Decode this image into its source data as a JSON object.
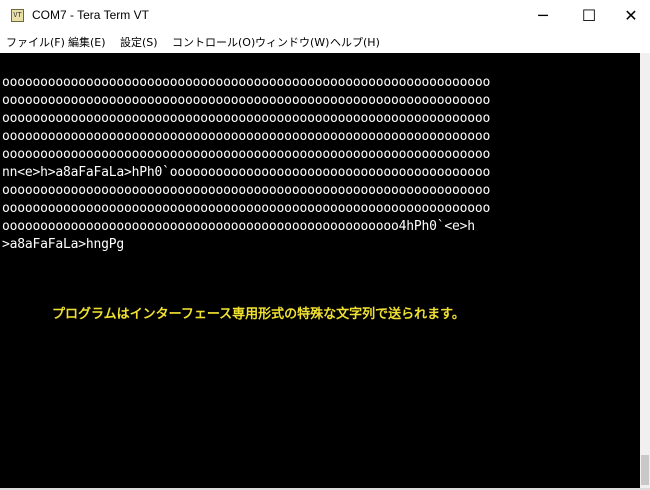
{
  "window": {
    "icon_text": "VT",
    "title": "COM7 - Tera Term VT",
    "minimize_glyph": "─",
    "maximize_glyph": "☐",
    "close_glyph": "✕"
  },
  "menu": {
    "items": [
      {
        "label": "ファイル(F)"
      },
      {
        "label": "編集(E)"
      },
      {
        "label": "設定(S)"
      },
      {
        "label": "コントロール(O)"
      },
      {
        "label": "ウィンドウ(W)"
      },
      {
        "label": "ヘルプ(H)"
      }
    ]
  },
  "terminal": {
    "lines": [
      "oooooooooooooooooooooooooooooooooooooooooooooooooooooooooooooooo",
      "oooooooooooooooooooooooooooooooooooooooooooooooooooooooooooooooo",
      "oooooooooooooooooooooooooooooooooooooooooooooooooooooooooooooooo",
      "oooooooooooooooooooooooooooooooooooooooooooooooooooooooooooooooo",
      "oooooooooooooooooooooooooooooooooooooooooooooooooooooooooooooooo",
      "nn<e>h>a8aFaFaLa>hPh0`oooooooooooooooooooooooooooooooooooooooooo",
      "oooooooooooooooooooooooooooooooooooooooooooooooooooooooooooooooo",
      "oooooooooooooooooooooooooooooooooooooooooooooooooooooooooooooooo",
      "oooooooooooooooooooooooooooooooooooooooooooooooooooo4hPh0`<e>h",
      ">a8aFaFaLa>hngPg"
    ],
    "caption": "プログラムはインターフェース専用形式の特殊な文字列で送られます。"
  },
  "colors": {
    "terminal_bg": "#000000",
    "terminal_fg": "#ffffff",
    "caption": "#f0e030"
  }
}
